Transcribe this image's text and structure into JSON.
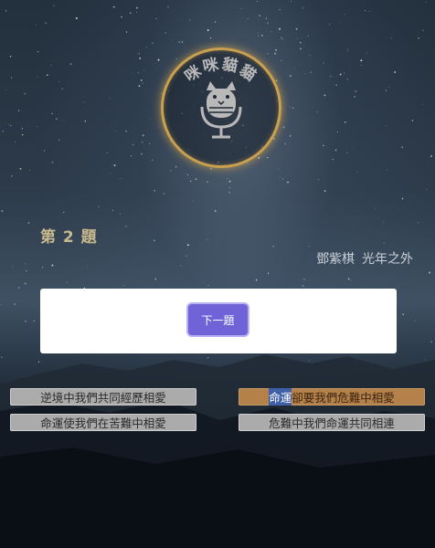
{
  "logo": {
    "text": "咪咪貓貓"
  },
  "quiz": {
    "question_label": "第 2 題",
    "artist": "鄧紫棋",
    "song": "光年之外",
    "next_button": "下一題"
  },
  "options": [
    {
      "label": "逆境中我們共同經歷相愛",
      "selected": false
    },
    {
      "highlight": "命運",
      "rest": "卻要我們危難中相愛",
      "selected": true
    },
    {
      "label": "命運使我們在苦難中相愛",
      "selected": false
    },
    {
      "label": "危難中我們命運共同相連",
      "selected": false
    }
  ],
  "colors": {
    "button": "#7063d8",
    "selected_option": "#b5814a",
    "option": "#ababab",
    "logo_ring": "#c9a050",
    "text_highlight": "#3f5fa8"
  }
}
